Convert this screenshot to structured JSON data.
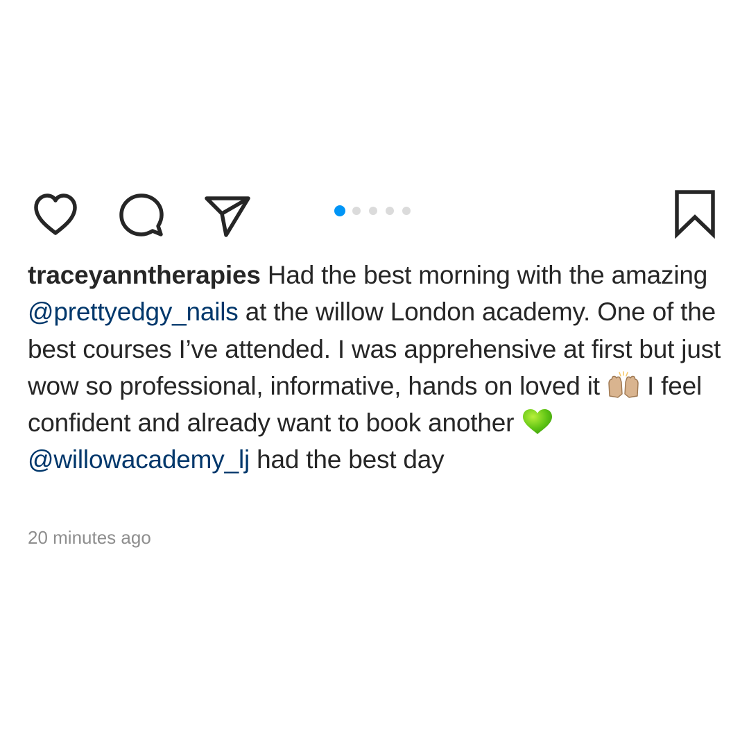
{
  "post": {
    "actions": {
      "like_icon": "heart-icon",
      "comment_icon": "comment-icon",
      "share_icon": "paper-plane-icon",
      "save_icon": "bookmark-icon"
    },
    "carousel": {
      "total_slides": 5,
      "active_slide": 1,
      "active_color": "#0095f6",
      "inactive_color": "#dbdbdb"
    },
    "caption": {
      "username": "traceyanntherapies",
      "text_1": " Had the best morning with the amazing ",
      "mention_1": "@prettyedgy_nails",
      "text_2": " at the willow London academy. One of the best courses I’ve attended. I was apprehensive at first but just wow so professional, informative, hands on loved it ",
      "emoji_1": "raising-hands-emoji",
      "text_3": " I feel confident and already want to book another ",
      "emoji_2": "green-heart-emoji",
      "text_4": " ",
      "mention_2": "@willowacademy_lj",
      "text_5": " had the best day"
    },
    "timestamp": "20 minutes ago",
    "colors": {
      "text": "#262626",
      "mention": "#00376b",
      "timestamp": "#8e8e8e",
      "accent": "#0095f6"
    }
  }
}
